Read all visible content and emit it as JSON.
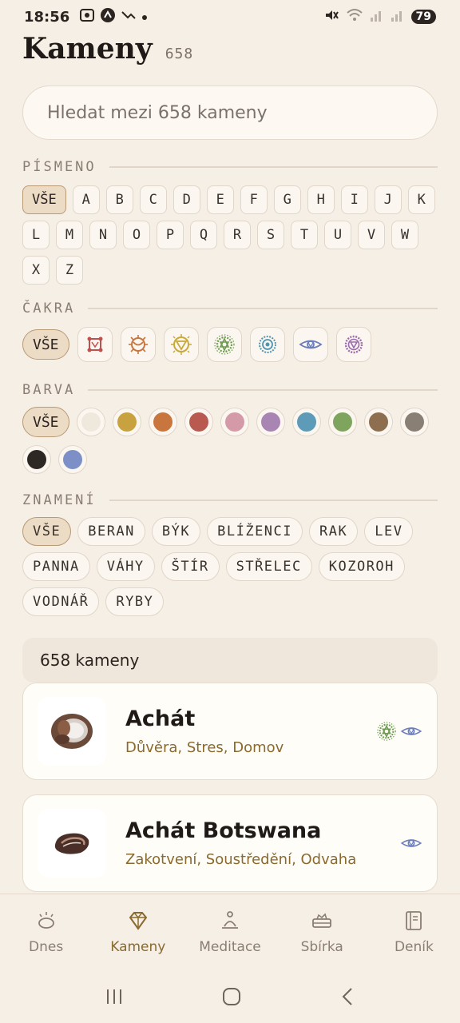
{
  "status": {
    "time": "18:56",
    "battery": "79"
  },
  "header": {
    "title": "Kameny",
    "count": "658"
  },
  "search": {
    "placeholder": "Hledat mezi 658 kameny"
  },
  "letters": {
    "title": "PÍSMENO",
    "items": [
      "VŠE",
      "A",
      "B",
      "C",
      "D",
      "E",
      "F",
      "G",
      "H",
      "I",
      "J",
      "K",
      "L",
      "M",
      "N",
      "O",
      "P",
      "Q",
      "R",
      "S",
      "T",
      "U",
      "V",
      "W",
      "X",
      "Z"
    ]
  },
  "chakra": {
    "title": "ČAKRA",
    "all_label": "VŠE",
    "icons": [
      {
        "name": "root-chakra-icon",
        "color": "#c0504d"
      },
      {
        "name": "sacral-chakra-icon",
        "color": "#c8763e"
      },
      {
        "name": "solar-plexus-chakra-icon",
        "color": "#c9a93a"
      },
      {
        "name": "heart-chakra-icon",
        "color": "#6e9b52"
      },
      {
        "name": "throat-chakra-icon",
        "color": "#4f95b0"
      },
      {
        "name": "third-eye-chakra-icon",
        "color": "#6b7dbb"
      },
      {
        "name": "crown-chakra-icon",
        "color": "#9b6bb0"
      }
    ]
  },
  "color": {
    "title": "BARVA",
    "all_label": "VŠE",
    "swatches": [
      "#efe8dd",
      "#c7a23e",
      "#c8763e",
      "#b85a50",
      "#d59aa8",
      "#a985b3",
      "#5d9bb8",
      "#7ea45e",
      "#8d6e4e",
      "#8a7f74",
      "#2e2825",
      "#7c8fc6"
    ]
  },
  "zodiac": {
    "title": "ZNAMENÍ",
    "items": [
      "VŠE",
      "BERAN",
      "BÝK",
      "BLÍŽENCI",
      "RAK",
      "LEV",
      "PANNA",
      "VÁHY",
      "ŠTÍR",
      "STŘELEC",
      "KOZOROH",
      "VODNÁŘ",
      "RYBY"
    ]
  },
  "results": {
    "count_label": "658 kameny",
    "items": [
      {
        "name": "Achát",
        "tags": "Důvěra, Stres, Domov",
        "chakras": [
          "heart",
          "third-eye"
        ]
      },
      {
        "name": "Achát Botswana",
        "tags": "Zakotvení, Soustředění, Odvaha",
        "chakras": [
          "third-eye"
        ]
      }
    ]
  },
  "nav": {
    "items": [
      {
        "label": "Dnes",
        "icon": "sunrise-icon"
      },
      {
        "label": "Kameny",
        "icon": "gem-icon"
      },
      {
        "label": "Meditace",
        "icon": "meditation-icon"
      },
      {
        "label": "Sbírka",
        "icon": "collection-icon"
      },
      {
        "label": "Deník",
        "icon": "journal-icon"
      }
    ],
    "active": "Kameny"
  }
}
